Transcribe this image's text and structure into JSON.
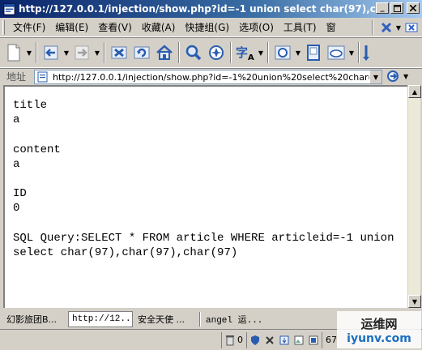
{
  "window": {
    "title": "http://127.0.0.1/injection/show.php?id=-1 union select char(97),char(97),c..."
  },
  "menu": {
    "items": [
      "文件(F)",
      "编辑(E)",
      "查看(V)",
      "收藏(A)",
      "快捷组(G)",
      "选项(O)",
      "工具(T)",
      "窗"
    ]
  },
  "toolbar": {
    "buttons": [
      "new-page-icon",
      "back-icon",
      "forward-icon",
      "stop-icon",
      "refresh-icon",
      "home-icon",
      "search-icon",
      "favorites-icon",
      "encoding-icon",
      "ie-icon",
      "screen-icon",
      "sky-icon"
    ]
  },
  "address": {
    "label": "地址",
    "url": "http://127.0.0.1/injection/show.php?id=-1%20union%20select%20char(97),cha"
  },
  "page": {
    "blocks": [
      {
        "label": "title",
        "value": "a"
      },
      {
        "label": "content",
        "value": "a"
      },
      {
        "label": "ID",
        "value": "0"
      }
    ],
    "sql_line1": "SQL Query:SELECT * FROM article WHERE articleid=-1 union",
    "sql_line2": "select char(97),char(97),char(97)"
  },
  "tabs": [
    {
      "label": "幻影旅团B..."
    },
    {
      "label": "http://12..."
    },
    {
      "label": "安全天使 ..."
    },
    {
      "label": "angel 运..."
    }
  ],
  "status": {
    "trash_count": "0",
    "zoom": "67"
  },
  "watermark": {
    "top": "运维网",
    "bottom": "iyunv.com"
  }
}
